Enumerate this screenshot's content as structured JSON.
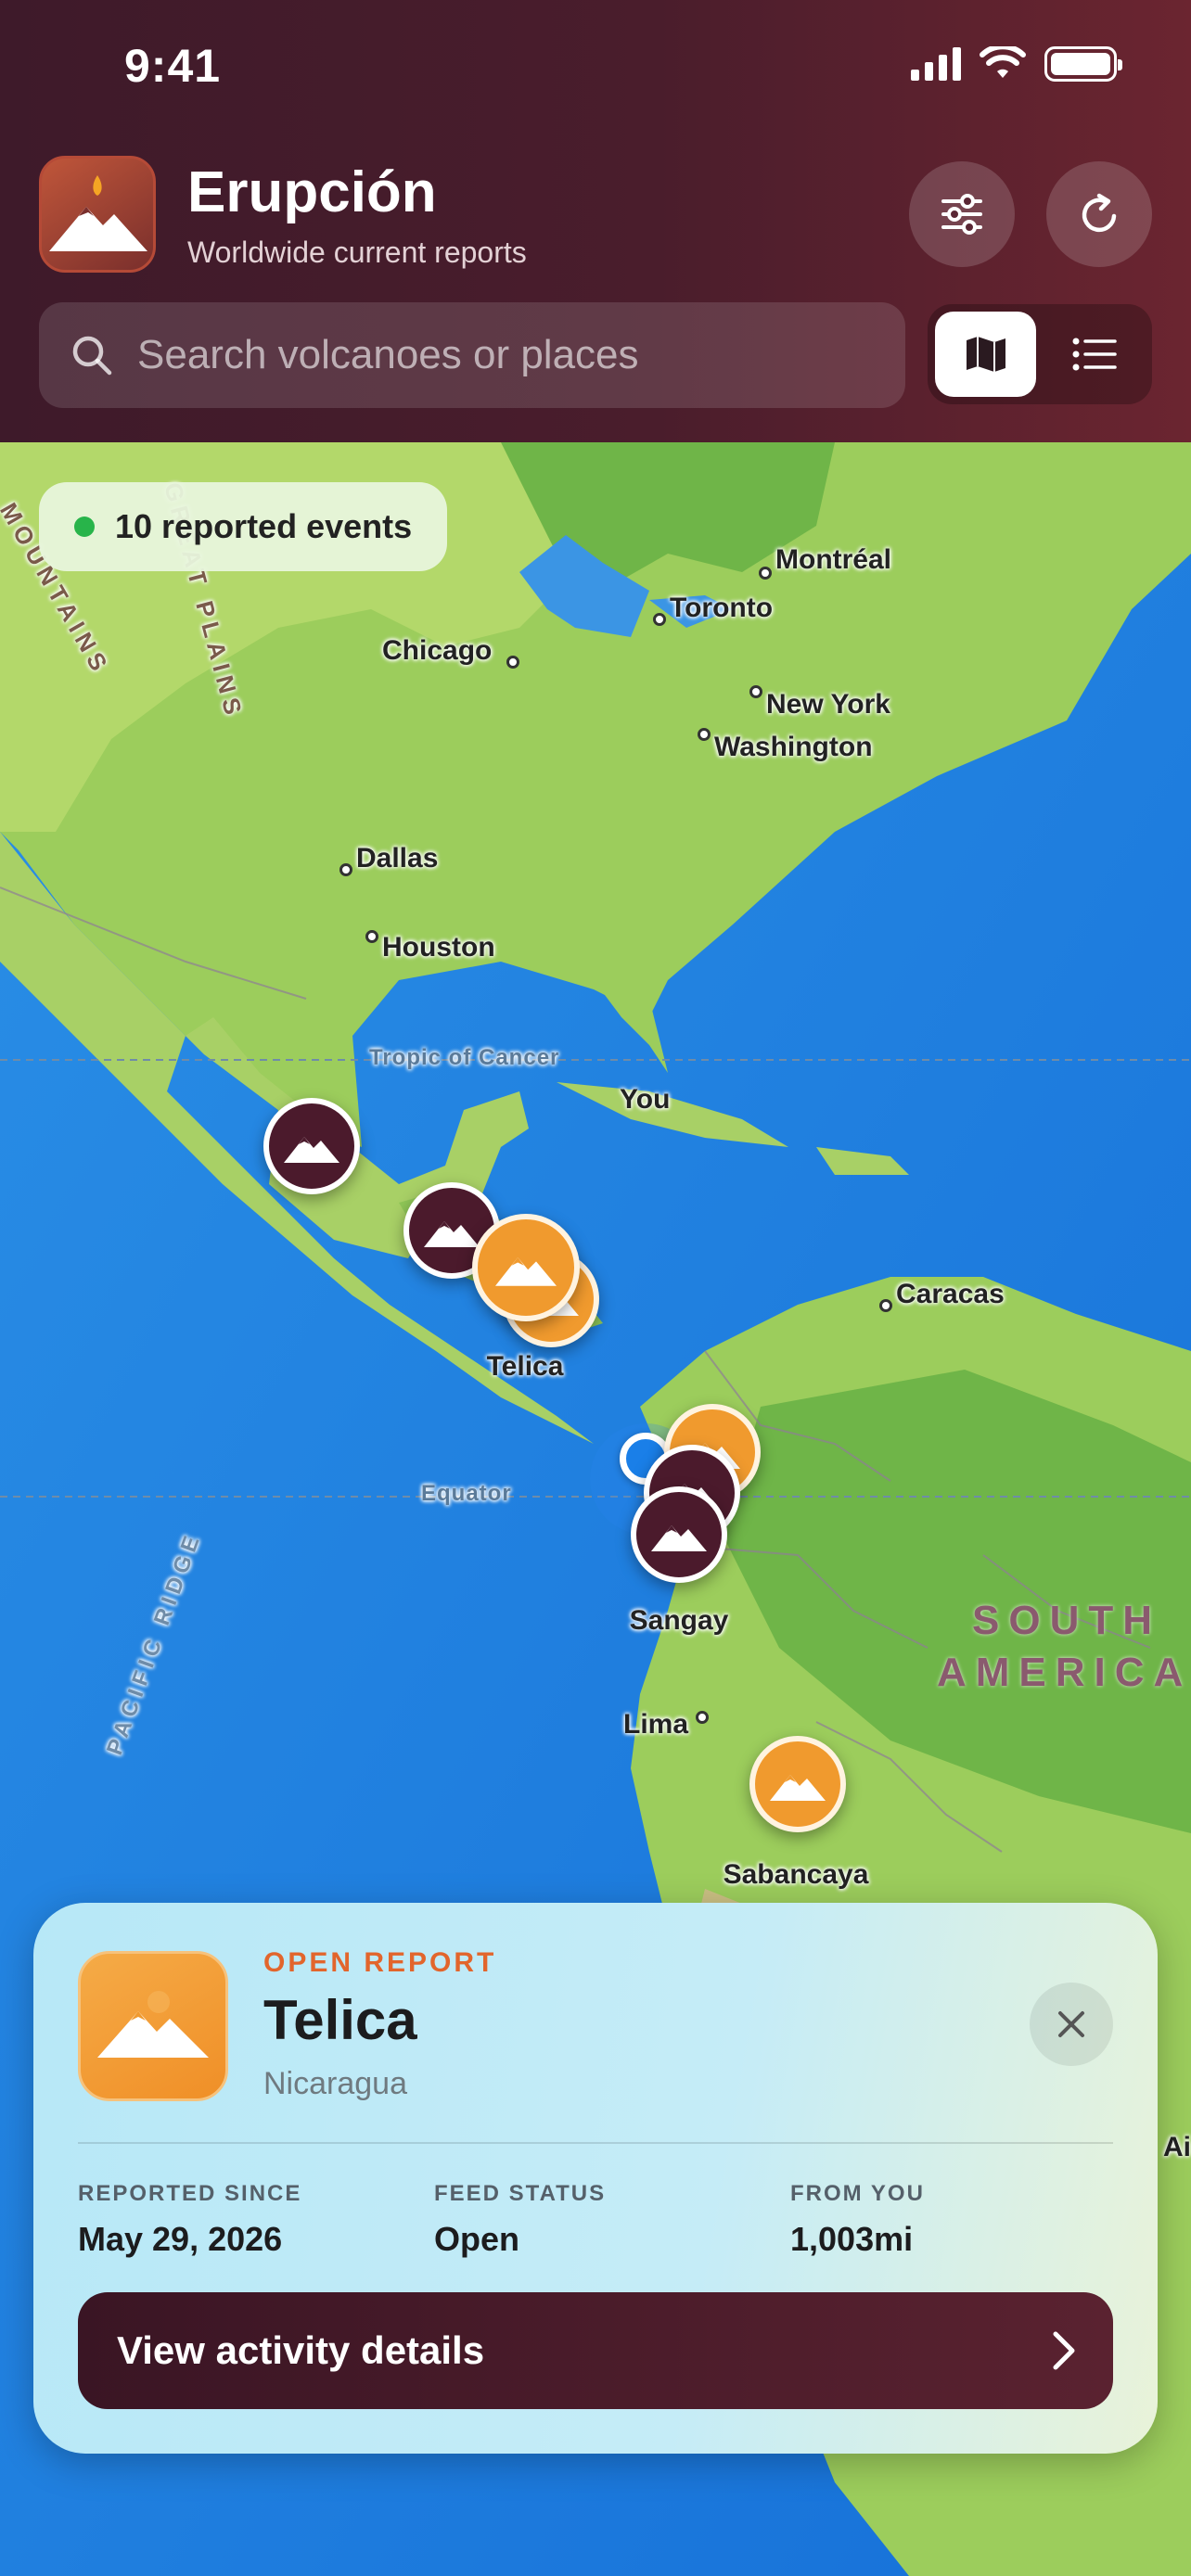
{
  "status_bar": {
    "time": "9:41"
  },
  "header": {
    "app_title": "Erupción",
    "app_subtitle": "Worldwide current reports",
    "filter_icon": "sliders-icon",
    "refresh_icon": "refresh-icon"
  },
  "search": {
    "placeholder": "Search volcanoes or places"
  },
  "view_toggle": {
    "options": [
      "map",
      "list"
    ],
    "selected": "map"
  },
  "map": {
    "events_pill": "10 reported events",
    "cities": [
      "Montréal",
      "Toronto",
      "Chicago",
      "New York",
      "Washington",
      "Dallas",
      "Houston",
      "Caracas",
      "Lima"
    ],
    "reference_lines": [
      "Tropic of Cancer",
      "Equator"
    ],
    "mountain_labels": [
      "MOUNTAINS",
      "GREAT PLAINS",
      "PACIFIC RIDGE"
    ],
    "region_labels": [
      "SOUTH",
      "AMERICA"
    ],
    "edge_labels": {
      "right": "Ai"
    },
    "user_label": "You",
    "volcano_labels": [
      "Telica",
      "Sangay",
      "Sabancaya"
    ],
    "colors": {
      "dark_marker": "#4b1a2c",
      "orange_marker": "#f09a2e",
      "user_dot": "#1a7fe8"
    }
  },
  "card": {
    "kicker": "OPEN REPORT",
    "title": "Telica",
    "country": "Nicaragua",
    "stats": [
      {
        "label": "REPORTED SINCE",
        "value": "May 29, 2026"
      },
      {
        "label": "FEED STATUS",
        "value": "Open"
      },
      {
        "label": "FROM YOU",
        "value": "1,003mi"
      }
    ],
    "cta": "View activity details",
    "accent_color": "#e2652c"
  }
}
